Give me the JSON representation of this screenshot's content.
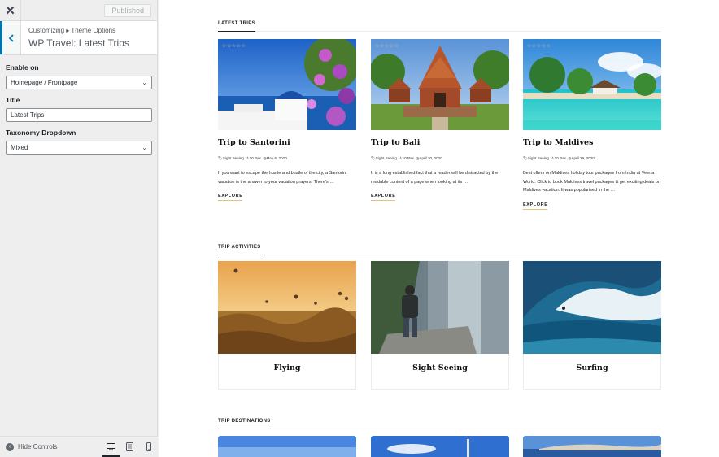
{
  "customizer": {
    "publish_label": "Published",
    "breadcrumb": "Customizing ▸ Theme Options",
    "section_title": "WP Travel: Latest Trips",
    "controls": [
      {
        "label": "Enable on",
        "value": "Homepage / Frontpage"
      },
      {
        "label": "Title",
        "value": "Latest Trips"
      },
      {
        "label": "Taxonomy Dropdown",
        "value": "Mixed"
      }
    ],
    "hide_controls_label": "Hide Controls",
    "close_icon": "close-icon",
    "back_icon": "chevron-left-icon",
    "accent_color": "#0073aa"
  },
  "preview": {
    "latest_trips": {
      "heading": "LATEST TRIPS",
      "trips": [
        {
          "title": "Trip to Santorini",
          "category": "Sight Seeing",
          "pax": "10 Pax",
          "date": "May 6, 2020",
          "description": "If you want to escape the hustle and bustle of the city, a Santorini vacation is the answer to your vacation prayers. There's …",
          "link": "EXPLORE"
        },
        {
          "title": "Trip to Bali",
          "category": "Sight Seeing",
          "pax": "10 Pax",
          "date": "April 30, 2020",
          "description": "It is a long established fact that a reader will be distracted by the readable content of a page when looking at its …",
          "link": "EXPLORE"
        },
        {
          "title": "Trip to Maldives",
          "category": "Sight Seeing",
          "pax": "10 Pax",
          "date": "April 29, 2020",
          "description": "Best offers on Maldives holiday tour packages from India at Veena World. Click to book Maldives travel packages & get exciting deals on Maldives vacation.  It was popularised in the …",
          "link": "EXPLORE"
        }
      ]
    },
    "trip_activities": {
      "heading": "TRIP ACTIVITIES",
      "items": [
        "Flying",
        "Sight Seeing",
        "Surfing"
      ]
    },
    "trip_destinations": {
      "heading": "TRIP DESTINATIONS"
    }
  }
}
